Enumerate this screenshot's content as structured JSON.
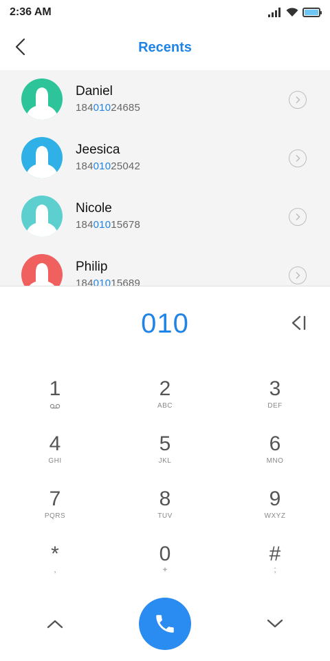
{
  "status_bar": {
    "time": "2:36 AM",
    "icons": [
      "signal-icon",
      "wifi-icon",
      "battery-icon"
    ],
    "battery_level": 1.0
  },
  "header": {
    "title": "Recents",
    "back_icon": "chevron-left-icon"
  },
  "colors": {
    "accent": "#1f84e6",
    "call_button": "#2a8cf0",
    "list_background": "#f4f4f4",
    "avatar_daniel": "#2ec49a",
    "avatar_jeesica": "#2fb0e6",
    "avatar_nicole": "#5ecfcf",
    "avatar_philip": "#f0605f"
  },
  "recents": [
    {
      "name": "Daniel",
      "number_prefix": "184",
      "number_match": "010",
      "number_suffix": "24685"
    },
    {
      "name": "Jeesica",
      "number_prefix": "184",
      "number_match": "010",
      "number_suffix": "25042"
    },
    {
      "name": "Nicole",
      "number_prefix": "184",
      "number_match": "010",
      "number_suffix": "15678"
    },
    {
      "name": "Philip",
      "number_prefix": "184",
      "number_match": "010",
      "number_suffix": "15689"
    }
  ],
  "dialer": {
    "entered_number": "010",
    "backspace_icon": "backspace-icon"
  },
  "keypad": [
    {
      "digit": "1",
      "sub": ""
    },
    {
      "digit": "2",
      "sub": "ABC"
    },
    {
      "digit": "3",
      "sub": "DEF"
    },
    {
      "digit": "4",
      "sub": "GHI"
    },
    {
      "digit": "5",
      "sub": "JKL"
    },
    {
      "digit": "6",
      "sub": "MNO"
    },
    {
      "digit": "7",
      "sub": "PQRS"
    },
    {
      "digit": "8",
      "sub": "TUV"
    },
    {
      "digit": "9",
      "sub": "WXYZ"
    },
    {
      "digit": "*",
      "sub": ","
    },
    {
      "digit": "0",
      "sub": "+"
    },
    {
      "digit": "#",
      "sub": ";"
    }
  ],
  "bottom_bar": {
    "up_icon": "chevron-up-icon",
    "call_icon": "phone-icon",
    "down_icon": "chevron-down-icon"
  }
}
